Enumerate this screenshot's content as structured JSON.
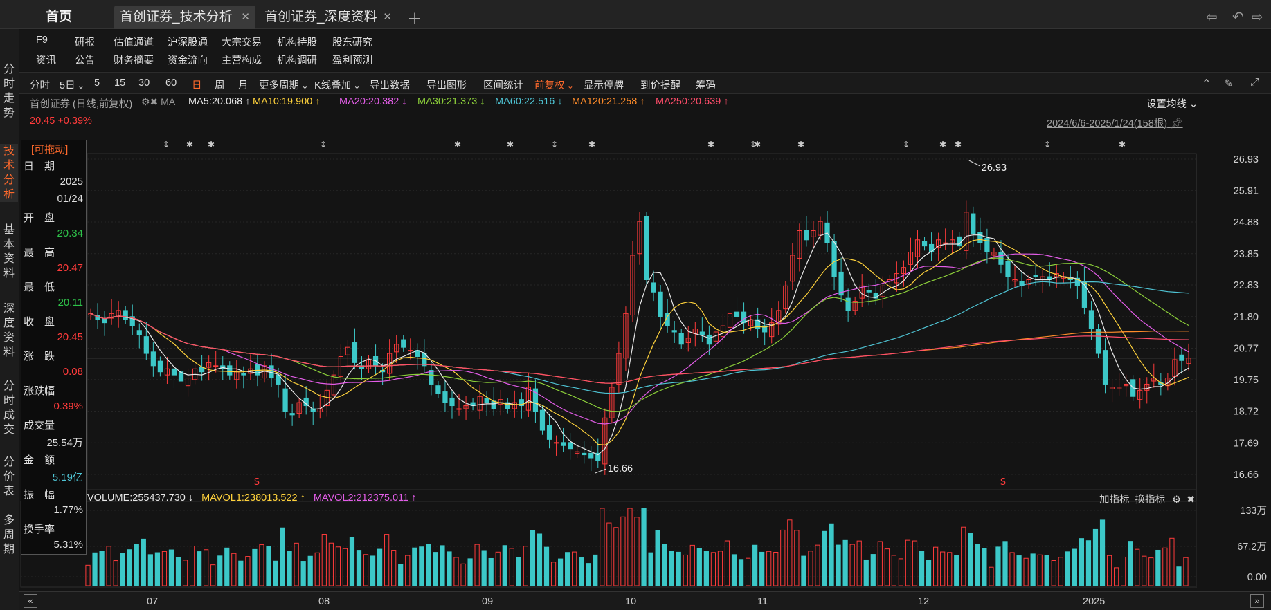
{
  "tabs": {
    "home": "首页",
    "active": "首创证券_技术分析",
    "second": "首创证券_深度资料",
    "close": "✕",
    "add": "＋"
  },
  "window_controls": [
    "⇦",
    "↶",
    "⇨"
  ],
  "left_nav": [
    "分时走势",
    "技术分析",
    "基本资料",
    "深度资料",
    "分时成交",
    "分价表",
    "多周期"
  ],
  "left_nav_active": "技术分析",
  "menu": {
    "row1": [
      "F9",
      "研报",
      "估值通道",
      "沪深股通",
      "大宗交易",
      "机构持股",
      "股东研究"
    ],
    "row2": [
      "资讯",
      "公告",
      "财务摘要",
      "资金流向",
      "主营构成",
      "机构调研",
      "盈利预测"
    ]
  },
  "toolbar": [
    "分时",
    "5日",
    "5",
    "15",
    "30",
    "60",
    "日",
    "周",
    "月",
    "更多周期",
    "K线叠加",
    "导出数据",
    "导出图形",
    "区间统计",
    "前复权",
    "显示停牌",
    "到价提醒",
    "筹码"
  ],
  "toolbar_active": [
    "日",
    "前复权"
  ],
  "price_title": "首创证券 (日线,前复权)",
  "ma_label": "MA",
  "ma_items": [
    {
      "text": "MA5:20.068 ↑",
      "color": "#e8e8e8"
    },
    {
      "text": "MA10:19.900 ↑",
      "color": "#ffd23c"
    },
    {
      "text": "MA20:20.382 ↓",
      "color": "#e35de8"
    },
    {
      "text": "MA30:21.373 ↓",
      "color": "#8ccf3a"
    },
    {
      "text": "MA60:22.516 ↓",
      "color": "#4fc4d4"
    },
    {
      "text": "MA120:21.258 ↑",
      "color": "#ff8c2a"
    },
    {
      "text": "MA250:20.639 ↑",
      "color": "#ff4d6a"
    }
  ],
  "setting_ma": "设置均线",
  "last_price": "20.45 +0.39%",
  "date_range": "2024/6/6-2025/1/24(158根)",
  "panel": {
    "header": "[可拖动]",
    "rows": [
      {
        "label": "日　期",
        "value": "2025",
        "color": "#e0e0e0"
      },
      {
        "label": "",
        "value": "01/24",
        "color": "#e0e0e0"
      },
      {
        "label": "开　盘",
        "value": "20.34",
        "color": "#2ec24a"
      },
      {
        "label": "最　高",
        "value": "20.47",
        "color": "#ff3b3b"
      },
      {
        "label": "最　低",
        "value": "20.11",
        "color": "#2ec24a"
      },
      {
        "label": "收　盘",
        "value": "20.45",
        "color": "#ff3b3b"
      },
      {
        "label": "涨　跌",
        "value": "0.08",
        "color": "#ff3b3b"
      },
      {
        "label": "涨跌幅",
        "value": "0.39%",
        "color": "#ff3b3b"
      },
      {
        "label": "成交量",
        "value": "25.54万",
        "color": "#e0e0e0"
      },
      {
        "label": "金　额",
        "value": "5.19亿",
        "color": "#4fc4d4"
      },
      {
        "label": "振　幅",
        "value": "1.77%",
        "color": "#e0e0e0"
      },
      {
        "label": "换手率",
        "value": "5.31%",
        "color": "#e0e0e0"
      }
    ]
  },
  "volume_legend": [
    {
      "text": "VOLUME:255437.730 ↓",
      "color": "#e8e8e8"
    },
    {
      "text": "MAVOL1:238013.522 ↑",
      "color": "#ffd23c"
    },
    {
      "text": "MAVOL2:212375.011 ↑",
      "color": "#e35de8"
    }
  ],
  "volume_tools": [
    "加指标",
    "换指标"
  ],
  "month_labels": [
    "07",
    "08",
    "09",
    "10",
    "11",
    "12",
    "2025"
  ],
  "colors": {
    "up": "#ff3b3b",
    "down": "#3cc8c8",
    "bg": "#141414",
    "accent": "#ff6a2c"
  },
  "chart_data": [
    {
      "type": "candlestick",
      "title": "首创证券 (日线,前复权)",
      "x_range": [
        "2024/6/6",
        "2025/1/24"
      ],
      "bar_count": 158,
      "y_ticks": [
        26.93,
        25.91,
        24.88,
        23.85,
        22.83,
        21.8,
        20.77,
        19.75,
        18.72,
        17.69,
        16.66
      ],
      "ylim": [
        16.66,
        26.93
      ],
      "annotations": [
        {
          "text": "26.93",
          "kind": "high"
        },
        {
          "text": "16.66",
          "kind": "low"
        }
      ],
      "current_price": 20.45,
      "close_series": [
        21.9,
        21.7,
        21.6,
        21.9,
        22.0,
        21.7,
        21.5,
        21.2,
        20.6,
        20.2,
        20.0,
        20.1,
        19.9,
        19.7,
        19.8,
        20.1,
        20.0,
        20.3,
        20.2,
        20.1,
        19.9,
        20.0,
        19.9,
        20.1,
        19.9,
        20.2,
        19.8,
        19.6,
        18.7,
        18.6,
        19.0,
        18.9,
        18.7,
        18.8,
        19.4,
        19.9,
        20.5,
        20.8,
        20.3,
        20.1,
        20.4,
        20.2,
        20.0,
        20.6,
        20.9,
        20.8,
        20.7,
        20.5,
        20.2,
        19.6,
        19.3,
        19.0,
        18.9,
        18.8,
        18.9,
        18.9,
        19.2,
        19.0,
        18.8,
        19.1,
        18.8,
        19.0,
        18.9,
        19.5,
        18.7,
        18.1,
        17.8,
        17.7,
        17.6,
        17.5,
        17.4,
        17.3,
        17.2,
        17.1,
        18.5,
        19.5,
        20.6,
        21.9,
        23.8,
        24.9,
        23.0,
        22.6,
        21.8,
        21.5,
        21.3,
        20.9,
        21.1,
        21.4,
        21.2,
        20.9,
        21.3,
        21.5,
        21.9,
        21.8,
        21.6,
        21.7,
        21.4,
        21.3,
        21.6,
        22.0,
        22.8,
        23.8,
        24.6,
        24.3,
        24.6,
        24.9,
        24.2,
        23.1,
        22.5,
        22.0,
        22.3,
        22.8,
        22.6,
        22.4,
        22.8,
        23.0,
        23.2,
        23.4,
        23.9,
        24.3,
        24.1,
        23.9,
        24.3,
        24.2,
        24.3,
        24.1,
        25.2,
        24.5,
        24.2,
        23.9,
        23.9,
        23.5,
        23.1,
        23.0,
        22.8,
        23.0,
        23.1,
        23.1,
        23.0,
        23.2,
        23.1,
        23.0,
        22.8,
        22.1,
        21.4,
        20.6,
        19.6,
        19.5,
        19.5,
        19.6,
        19.2,
        19.4,
        19.6,
        19.8,
        19.6,
        19.8,
        20.4,
        20.37,
        20.45
      ]
    },
    {
      "type": "bar",
      "title": "VOLUME",
      "y_ticks_labels": [
        "133万",
        "67.2万",
        "0.00"
      ],
      "ylim": [
        0,
        133
      ]
    }
  ]
}
